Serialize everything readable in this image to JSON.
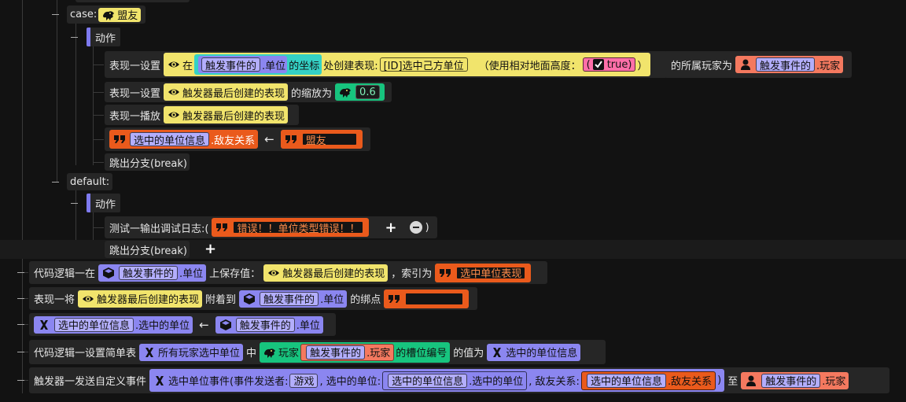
{
  "colors": {
    "yellow": "#f1e46c",
    "blue": "#8b86f0",
    "cyan": "#34d1c5",
    "orange": "#ea5a1c",
    "salmon": "#f4795f",
    "green": "#17c47e",
    "pink": "#ff6fa8"
  },
  "case_block": {
    "label": "case:",
    "value": "盟友",
    "action": "动作"
  },
  "r1": {
    "t1": "表现一设置",
    "t2": "在",
    "event": "触发事件的",
    "unit": ".单位",
    "coord": "的坐标",
    "t3": "处创建表现:",
    "preset": "[ID]选中己方单位",
    "t4": "（使用相对地面高度：",
    "bool": "true",
    "t5": "）",
    "t6": "的所属玩家为",
    "event2": "触发事件的",
    "player": ".玩家"
  },
  "r2": {
    "t1": "表现一设置",
    "ref": "触发器最后创建的表现",
    "t2": "的缩放为",
    "num": "0.6"
  },
  "r3": {
    "t1": "表现一播放",
    "ref": "触发器最后创建的表现"
  },
  "r4": {
    "info": "选中的单位信息",
    "field": ".敌友关系",
    "arrow": "←",
    "value": "盟友"
  },
  "r5": {
    "t1": "跳出分支(break)"
  },
  "default_block": {
    "label": "default:",
    "action": "动作"
  },
  "r6": {
    "t1": "测试一输出调试日志:(",
    "msg": "错误！！单位类型错误！！",
    "t2": ")"
  },
  "r7": {
    "t1": "跳出分支(break)"
  },
  "r8": {
    "t1": "代码逻辑一在",
    "event": "触发事件的",
    "unit": ".单位",
    "t2": "上保存值：",
    "ref": "触发器最后创建的表现",
    "t3": "，索引为",
    "key": "选中单位表现"
  },
  "r9": {
    "t1": "表现一将",
    "ref": "触发器最后创建的表现",
    "t2": "附着到",
    "event": "触发事件的",
    "unit": ".单位",
    "t3": "的绑点",
    "val": ""
  },
  "r10": {
    "info": "选中的单位信息",
    "field": ".选中的单位",
    "arrow": "←",
    "event": "触发事件的",
    "unit": ".单位"
  },
  "r11": {
    "t1": "代码逻辑一设置简单表",
    "table": "所有玩家选中单位",
    "t2": "中",
    "player_type": "玩家",
    "event": "触发事件的",
    "player": ".玩家",
    "slot": "的槽位编号",
    "t3": "的值为",
    "val": "选中的单位信息"
  },
  "r12": {
    "t1": "触发器一发送自定义事件",
    "evt": "选中单位事件(事件发送者:",
    "sender": "游戏",
    "p2": ", 选中的单位:",
    "info1": "选中的单位信息",
    "f1": ".选中的单位",
    "p3": ", 敌友关系:",
    "info2": "选中的单位信息",
    "f2": ".敌友关系",
    "close": ")",
    "t2": "至",
    "event": "触发事件的",
    "player": ".玩家"
  },
  "icons": [
    "eye-icon",
    "cube-icon",
    "function-icon",
    "quote-icon",
    "player-icon",
    "race-icon",
    "checkbox-icon",
    "plus-icon",
    "minus-icon"
  ]
}
